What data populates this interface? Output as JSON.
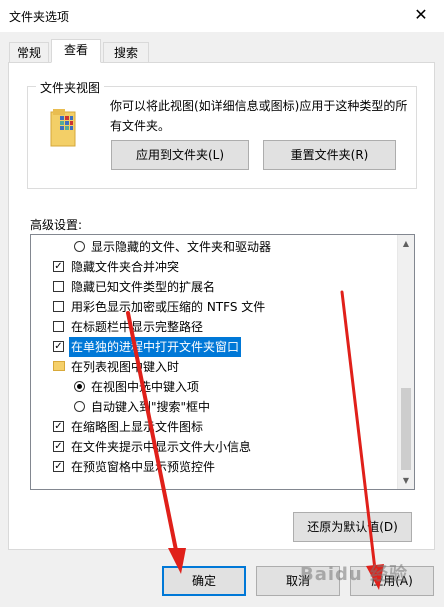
{
  "window": {
    "title": "文件夹选项",
    "close_glyph": "✕"
  },
  "tabs": [
    {
      "label": "常规",
      "active": false
    },
    {
      "label": "查看",
      "active": true
    },
    {
      "label": "搜索",
      "active": false
    }
  ],
  "folder_views": {
    "title": "文件夹视图",
    "description": "你可以将此视图(如详细信息或图标)应用于这种类型的所有文件夹。",
    "apply_button": "应用到文件夹(L)",
    "reset_button": "重置文件夹(R)"
  },
  "advanced": {
    "label": "高级设置:",
    "items": [
      {
        "kind": "radio",
        "checked": false,
        "indent": 2,
        "text": "显示隐藏的文件、文件夹和驱动器"
      },
      {
        "kind": "checkbox",
        "checked": true,
        "indent": 1,
        "text": "隐藏文件夹合并冲突"
      },
      {
        "kind": "checkbox",
        "checked": false,
        "indent": 1,
        "text": "隐藏已知文件类型的扩展名"
      },
      {
        "kind": "checkbox",
        "checked": false,
        "indent": 1,
        "text": "用彩色显示加密或压缩的 NTFS 文件"
      },
      {
        "kind": "checkbox",
        "checked": false,
        "indent": 1,
        "text": "在标题栏中显示完整路径"
      },
      {
        "kind": "checkbox",
        "checked": true,
        "indent": 1,
        "text": "在单独的进程中打开文件夹窗口",
        "highlighted": true
      },
      {
        "kind": "folder",
        "checked": false,
        "indent": 1,
        "text": "在列表视图中键入时"
      },
      {
        "kind": "radio",
        "checked": true,
        "indent": 2,
        "text": "在视图中选中键入项"
      },
      {
        "kind": "radio",
        "checked": false,
        "indent": 2,
        "text": "自动键入到\"搜索\"框中"
      },
      {
        "kind": "checkbox",
        "checked": true,
        "indent": 1,
        "text": "在缩略图上显示文件图标"
      },
      {
        "kind": "checkbox",
        "checked": true,
        "indent": 1,
        "text": "在文件夹提示中显示文件大小信息"
      },
      {
        "kind": "checkbox",
        "checked": true,
        "indent": 1,
        "text": "在预览窗格中显示预览控件"
      }
    ],
    "restore_button": "还原为默认值(D)"
  },
  "footer": {
    "ok_button": "确定",
    "cancel_button": "取消",
    "apply_button": "应用(A)"
  },
  "watermark": "Baidu 经验",
  "colors": {
    "selection": "#0078d7",
    "arrow": "#e0201a"
  }
}
